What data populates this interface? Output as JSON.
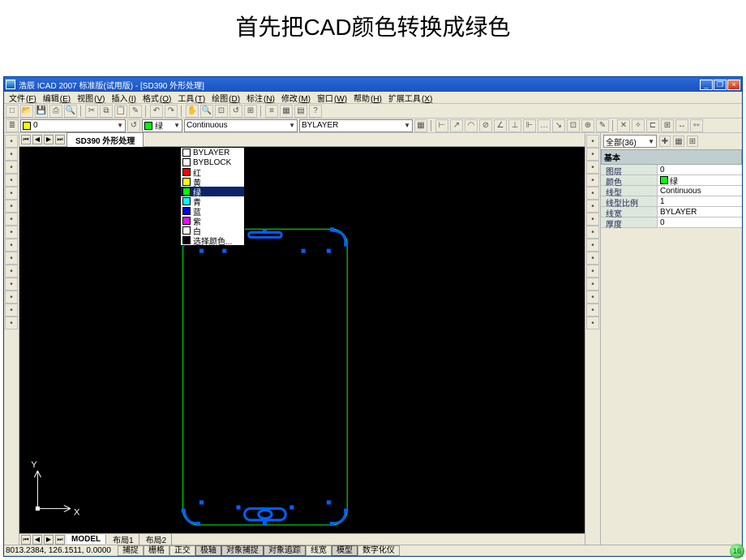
{
  "slide_title": "首先把CAD颜色转换成绿色",
  "slide_number": "16",
  "titlebar": {
    "title": "浩辰 ICAD 2007 标准版(试用版)  -  [SD390 外形处理]"
  },
  "menubar": [
    {
      "label": "文件",
      "hk": "(F)"
    },
    {
      "label": "编辑",
      "hk": "(E)"
    },
    {
      "label": "视图",
      "hk": "(V)"
    },
    {
      "label": "插入",
      "hk": "(I)"
    },
    {
      "label": "格式",
      "hk": "(O)"
    },
    {
      "label": "工具",
      "hk": "(T)"
    },
    {
      "label": "绘图",
      "hk": "(D)"
    },
    {
      "label": "标注",
      "hk": "(N)"
    },
    {
      "label": "修改",
      "hk": "(M)"
    },
    {
      "label": "窗口",
      "hk": "(W)"
    },
    {
      "label": "帮助",
      "hk": "(H)"
    },
    {
      "label": "扩展工具",
      "hk": "(X)"
    }
  ],
  "layer_selector": {
    "value": "0",
    "color": "#ffff00"
  },
  "color_selector": {
    "label": "绿",
    "swatch": "#00ff00"
  },
  "linetype_selector": {
    "label": "Continuous"
  },
  "lineweight_selector": {
    "label": "BYLAYER"
  },
  "color_dropdown": [
    {
      "label": "BYLAYER",
      "swatch": "#ffffff"
    },
    {
      "label": "BYBLOCK",
      "swatch": "#ffffff"
    },
    {
      "label": "红",
      "swatch": "#ff0000"
    },
    {
      "label": "黄",
      "swatch": "#ffff00"
    },
    {
      "label": "绿",
      "swatch": "#00ff00",
      "selected": true
    },
    {
      "label": "青",
      "swatch": "#00ffff"
    },
    {
      "label": "蓝",
      "swatch": "#0000ff"
    },
    {
      "label": "紫",
      "swatch": "#ff00ff"
    },
    {
      "label": "白",
      "swatch": "#ffffff"
    },
    {
      "label": "选择颜色...",
      "swatch": "#000000"
    }
  ],
  "document_tab": "SD390 外形处理",
  "model_tabs": {
    "model": "MODEL",
    "layout1": "布局1",
    "layout2": "布局2"
  },
  "prop_panel": {
    "filter_label": "全部(36)",
    "section": "基本",
    "rows": [
      {
        "k": "图层",
        "v": "0"
      },
      {
        "k": "颜色",
        "v": "绿",
        "swatch": "#00ff00"
      },
      {
        "k": "线型",
        "v": "Continuous"
      },
      {
        "k": "线型比例",
        "v": "1"
      },
      {
        "k": "线宽",
        "v": "BYLAYER"
      },
      {
        "k": "厚度",
        "v": "0"
      }
    ]
  },
  "statusbar": {
    "coords": "8013.2384, 126.1511, 0.0000",
    "modes": [
      {
        "label": "捕捉",
        "on": false
      },
      {
        "label": "栅格",
        "on": false
      },
      {
        "label": "正交",
        "on": false
      },
      {
        "label": "极轴",
        "on": true
      },
      {
        "label": "对象捕捉",
        "on": true
      },
      {
        "label": "对象追踪",
        "on": true
      },
      {
        "label": "线宽",
        "on": false
      },
      {
        "label": "模型",
        "on": true
      },
      {
        "label": "数字化仪",
        "on": false
      }
    ]
  }
}
